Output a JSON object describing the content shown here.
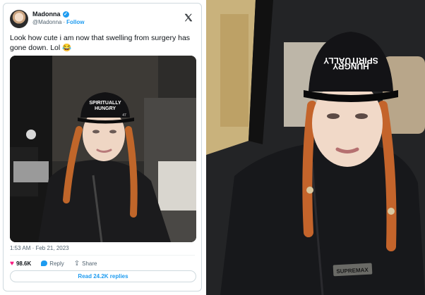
{
  "tweet": {
    "display_name": "Madonna",
    "handle": "@Madonna",
    "separator": "·",
    "follow_label": "Follow",
    "text": "Look how cute i am now that swelling from surgery has gone down. Lol 😂",
    "timestamp": "1:53 AM · Feb 21, 2023",
    "like_count": "98.6K",
    "reply_label": "Reply",
    "share_label": "Share",
    "read_replies_label": "Read 24.2K replies",
    "verified_color": "#1d9bf0",
    "like_color": "#f91880"
  },
  "photo_tweet": {
    "hat_text_line1": "SPIRITUALLY",
    "hat_text_line2": "HUNGRY",
    "hat_brand": "47"
  },
  "photo_car": {
    "hat_text_line1": "SPIRITUALLY",
    "hat_text_line2": "HUNGRY",
    "patch_text": "SUPREMAX"
  }
}
